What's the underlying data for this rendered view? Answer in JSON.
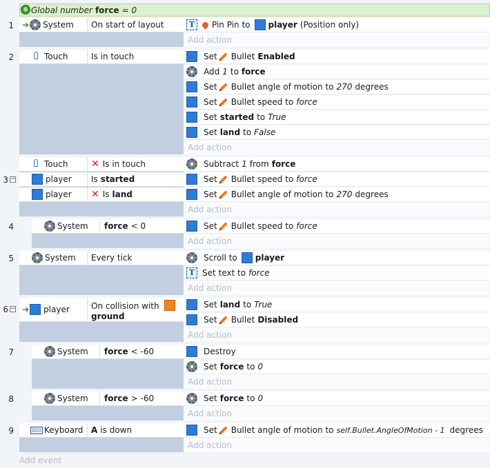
{
  "global_var": {
    "prefix": "Global number",
    "name": "force",
    "suffix": "= 0"
  },
  "events": [
    {
      "num": "1",
      "conditions": [
        {
          "object": "System",
          "text": "On start of layout"
        }
      ],
      "actions": [
        {
          "icon": "text",
          "parts": [
            "Pin Pin to",
            "player",
            "(Position only)"
          ]
        }
      ],
      "add_action": "Add action"
    },
    {
      "num": "2",
      "conditions": [
        {
          "object": "Touch",
          "text": "Is in touch"
        }
      ],
      "actions": [
        {
          "parts": [
            "Set",
            "Bullet",
            "Enabled"
          ]
        },
        {
          "parts": [
            "Add",
            "1",
            "to",
            "force"
          ]
        },
        {
          "parts": [
            "Set",
            "Bullet angle of motion to",
            "270",
            "degrees"
          ]
        },
        {
          "parts": [
            "Set",
            "Bullet speed to",
            "force"
          ]
        },
        {
          "parts": [
            "Set",
            "started",
            "to",
            "True"
          ]
        },
        {
          "parts": [
            "Set",
            "land",
            "to",
            "False"
          ]
        }
      ],
      "add_action": "Add action"
    },
    {
      "num": "3",
      "conditions": [
        {
          "object": "Touch",
          "text": "Is in touch"
        },
        {
          "object": "player",
          "pre": "Is",
          "bold": "started"
        },
        {
          "object": "player",
          "pre": "Is",
          "bold": "land"
        }
      ],
      "actions": [
        {
          "parts": [
            "Subtract",
            "1",
            "from",
            "force"
          ]
        },
        {
          "parts": [
            "Set",
            "Bullet speed to",
            "force"
          ]
        },
        {
          "parts": [
            "Set",
            "Bullet angle of motion to",
            "270",
            "degrees"
          ]
        }
      ],
      "add_action": "Add action"
    },
    {
      "num": "4",
      "conditions": [
        {
          "object": "System",
          "bold": "force",
          "text": "< 0"
        }
      ],
      "actions": [
        {
          "parts": [
            "Set",
            "Bullet speed to",
            "force"
          ]
        }
      ],
      "add_action": "Add action"
    },
    {
      "num": "5",
      "conditions": [
        {
          "object": "System",
          "text": "Every tick"
        }
      ],
      "actions": [
        {
          "parts": [
            "Scroll to",
            "player"
          ]
        },
        {
          "parts": [
            "Set text to",
            "force"
          ]
        }
      ],
      "add_action": "Add action"
    },
    {
      "num": "6",
      "conditions": [
        {
          "object": "player",
          "text": "On collision with",
          "bold": "ground"
        }
      ],
      "actions": [
        {
          "parts": [
            "Set",
            "land",
            "to",
            "True"
          ]
        },
        {
          "parts": [
            "Set",
            "Bullet",
            "Disabled"
          ]
        }
      ],
      "add_action": "Add action"
    },
    {
      "num": "7",
      "conditions": [
        {
          "object": "System",
          "bold": "force",
          "text": "< -60"
        }
      ],
      "actions": [
        {
          "parts": [
            "Destroy"
          ]
        },
        {
          "parts": [
            "Set",
            "force",
            "to",
            "0"
          ]
        }
      ],
      "add_action": "Add action"
    },
    {
      "num": "8",
      "conditions": [
        {
          "object": "System",
          "bold": "force",
          "text": "> -60"
        }
      ],
      "actions": [
        {
          "parts": [
            "Set",
            "force",
            "to",
            "0"
          ]
        }
      ],
      "add_action": "Add action"
    },
    {
      "num": "9",
      "conditions": [
        {
          "object": "Keyboard",
          "bold": "A",
          "text": "is down"
        }
      ],
      "actions": [
        {
          "parts": [
            "Set",
            "Bullet angle of motion to",
            "self.Bullet.AngleOfMotion - 1",
            "degrees"
          ]
        }
      ],
      "add_action": "Add action"
    }
  ],
  "add_event": "Add event",
  "colors": {
    "accent": "#2f7bd8",
    "condition_bg": "#c2cfe0",
    "global_bg": "#dbf0cf"
  }
}
